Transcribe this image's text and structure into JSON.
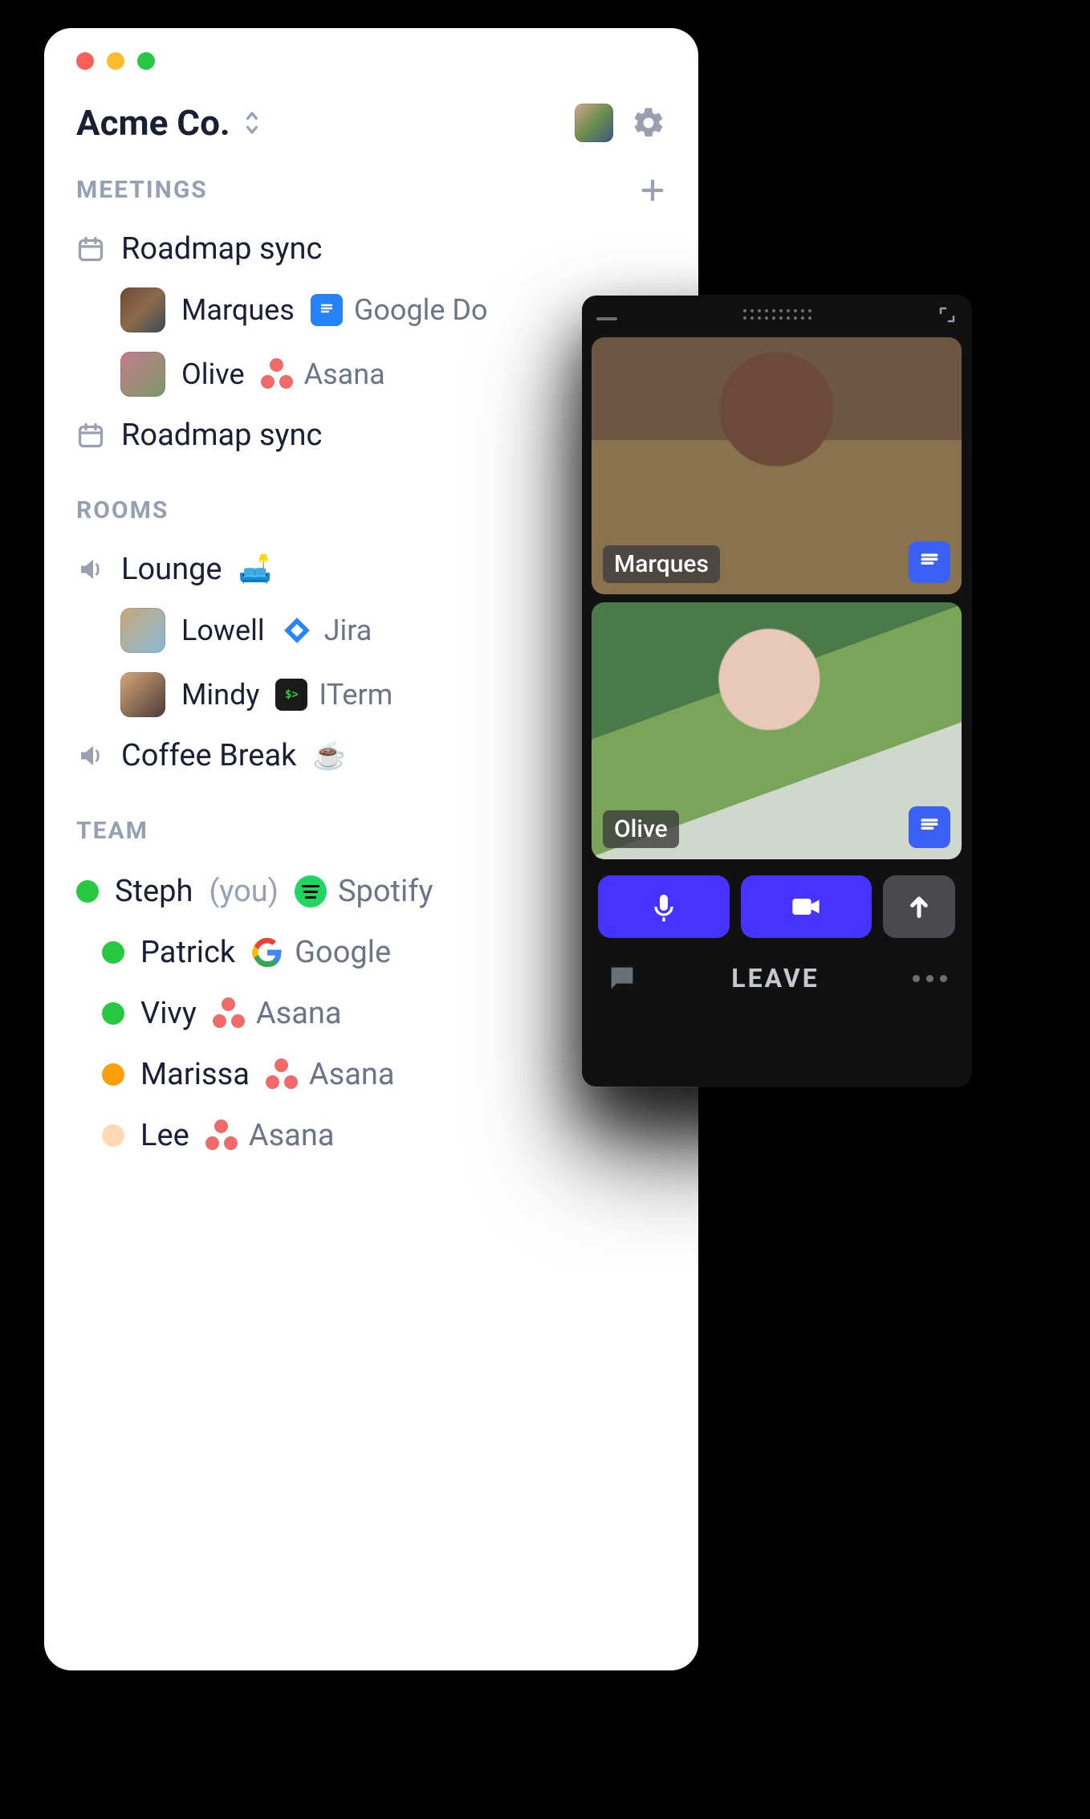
{
  "workspace": {
    "name": "Acme Co."
  },
  "sections": {
    "meetings_label": "MEETINGS",
    "rooms_label": "ROOMS",
    "team_label": "TEAM"
  },
  "meetings": [
    {
      "title": "Roadmap sync",
      "participants": [
        {
          "name": "Marques",
          "app_icon": "google-docs",
          "app_name": "Google Do"
        },
        {
          "name": "Olive",
          "app_icon": "asana",
          "app_name": "Asana"
        }
      ]
    },
    {
      "title": "Roadmap sync",
      "participants": []
    }
  ],
  "rooms": [
    {
      "title": "Lounge",
      "emoji": "🛋️",
      "participants": [
        {
          "name": "Lowell",
          "app_icon": "jira",
          "app_name": "Jira"
        },
        {
          "name": "Mindy",
          "app_icon": "iterm",
          "app_name": "ITerm"
        }
      ]
    },
    {
      "title": "Coffee Break",
      "emoji": "☕",
      "participants": []
    }
  ],
  "team": [
    {
      "name": "Steph",
      "you_label": "(you)",
      "presence": "green",
      "app_icon": "spotify",
      "app_name": "Spotify"
    },
    {
      "name": "Patrick",
      "presence": "green",
      "app_icon": "google",
      "app_name": "Google"
    },
    {
      "name": "Vivy",
      "presence": "green",
      "app_icon": "asana",
      "app_name": "Asana"
    },
    {
      "name": "Marissa",
      "presence": "orange",
      "app_icon": "asana",
      "app_name": "Asana"
    },
    {
      "name": "Lee",
      "presence": "peach",
      "app_icon": "asana",
      "app_name": "Asana"
    }
  ],
  "call": {
    "tiles": [
      {
        "name": "Marques"
      },
      {
        "name": "Olive"
      }
    ],
    "leave_label": "LEAVE"
  }
}
